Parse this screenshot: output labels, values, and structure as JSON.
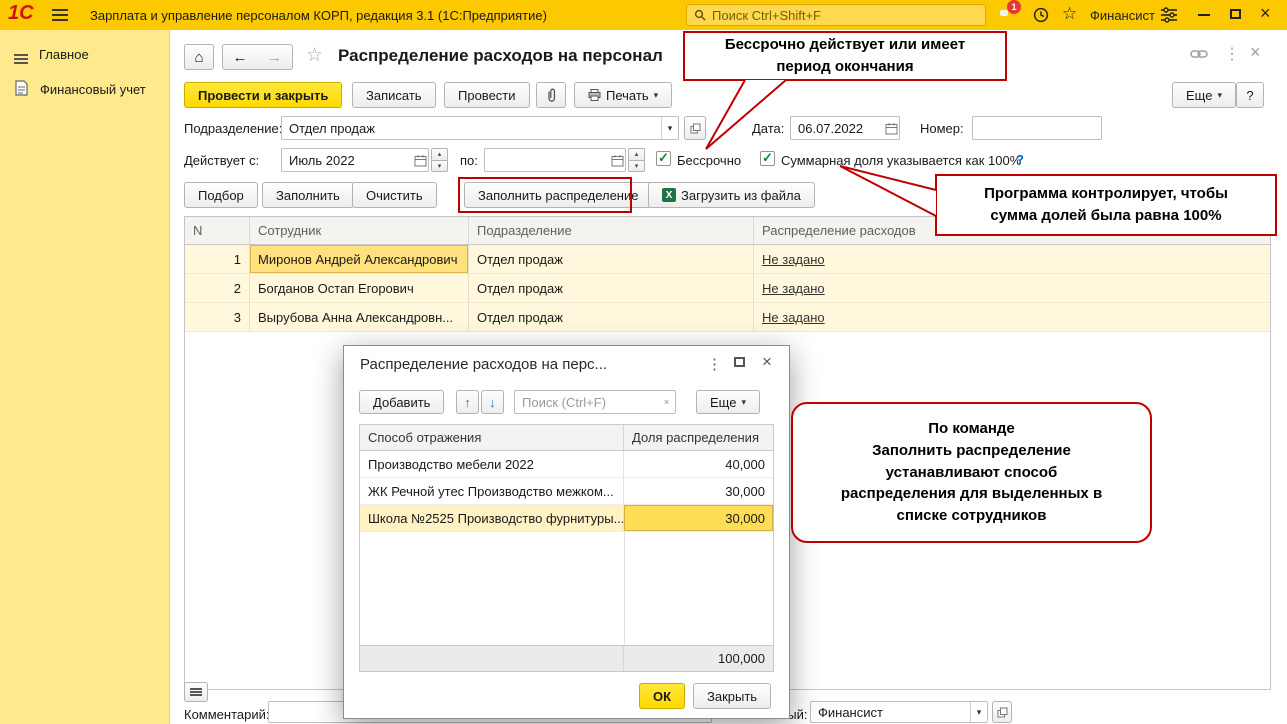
{
  "titlebar": {
    "logo": "1С",
    "app_title": "Зарплата и управление персоналом КОРП, редакция 3.1  (1С:Предприятие)",
    "search_placeholder": "Поиск Ctrl+Shift+F",
    "notification_count": "1",
    "user": "Финансист"
  },
  "sidebar": {
    "items": [
      {
        "label": "Главное"
      },
      {
        "label": "Финансовый учет"
      }
    ]
  },
  "form": {
    "title": "Распределение расходов на персонал",
    "toolbar": {
      "post_and_close": "Провести и закрыть",
      "write": "Записать",
      "post": "Провести",
      "print": "Печать",
      "more": "Еще",
      "help": "?"
    },
    "fields": {
      "department_label": "Подразделение:",
      "department_value": "Отдел продаж",
      "date_label": "Дата:",
      "date_value": "06.07.2022",
      "number_label": "Номер:",
      "number_value": "",
      "valid_from_label": "Действует с:",
      "valid_from_value": "Июль 2022",
      "valid_to_label": "по:",
      "valid_to_value": "",
      "perpetual_label": "Бессрочно",
      "sum_share_label": "Суммарная доля указывается как 100%",
      "sum_share_help": "?"
    },
    "commands": {
      "pick": "Подбор",
      "fill": "Заполнить",
      "clear": "Очистить",
      "fill_distribution": "Заполнить распределение",
      "load_from_file": "Загрузить из файла"
    },
    "table": {
      "columns": [
        "N",
        "Сотрудник",
        "Подразделение",
        "Распределение расходов"
      ],
      "rows": [
        {
          "n": "1",
          "employee": "Миронов Андрей Александрович",
          "department": "Отдел продаж",
          "distribution": "Не задано"
        },
        {
          "n": "2",
          "employee": "Богданов Остап Егорович",
          "department": "Отдел продаж",
          "distribution": "Не задано"
        },
        {
          "n": "3",
          "employee": "Вырубова Анна Александровн...",
          "department": "Отдел продаж",
          "distribution": "Не задано"
        }
      ]
    },
    "footer": {
      "comment_label": "Комментарий:",
      "comment_value": "",
      "responsible_label": "Ответственный:",
      "responsible_value": "Финансист"
    }
  },
  "dialog": {
    "title": "Распределение расходов на перс...",
    "toolbar": {
      "add": "Добавить",
      "search_placeholder": "Поиск (Ctrl+F)",
      "more": "Еще"
    },
    "table": {
      "columns": [
        "Способ отражения",
        "Доля распределения"
      ],
      "rows": [
        {
          "method": "Производство мебели 2022",
          "share": "40,000"
        },
        {
          "method": "ЖК Речной утес Производство межком...",
          "share": "30,000"
        },
        {
          "method": "Школа №2525 Производство фурнитуры...",
          "share": "30,000"
        }
      ],
      "total": "100,000"
    },
    "buttons": {
      "ok": "ОК",
      "close": "Закрыть"
    }
  },
  "annotations": {
    "perpetual": "Бессрочно действует или имеет\nпериод окончания",
    "sum_control": "Программа контролирует, чтобы\nсумма долей была равна 100%",
    "fill_command": "По команде\nЗаполнить распределение\nустанавливают способ\nраспределения для выделенных в\nсписке сотрудников"
  },
  "icons": {
    "home": "⌂",
    "back": "←",
    "forward": "→",
    "star": "☆",
    "menu_dots": "⋮",
    "close": "×",
    "dropdown": "▾",
    "spin_up": "▴",
    "spin_down": "▾",
    "check": "✓",
    "move_up": "↑",
    "move_down": "↓",
    "excel": "X",
    "clear": "×"
  },
  "colors": {
    "annotation_red": "#c00000",
    "brand_yellow": "#fcc900",
    "button_yellow": "#ffe01a",
    "check_green": "#0c8a2f",
    "selection_yellow": "#ffe27e"
  }
}
